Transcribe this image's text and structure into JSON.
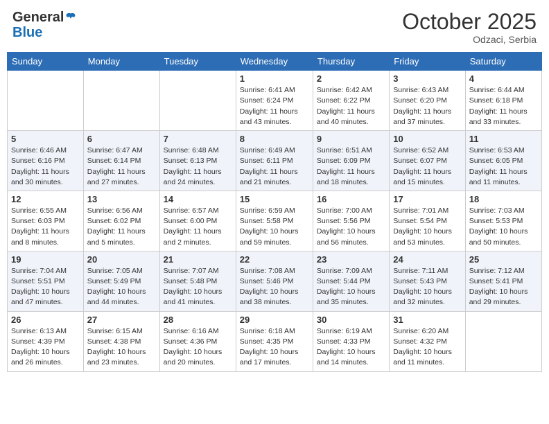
{
  "header": {
    "logo_general": "General",
    "logo_blue": "Blue",
    "month_title": "October 2025",
    "location": "Odzaci, Serbia"
  },
  "days_of_week": [
    "Sunday",
    "Monday",
    "Tuesday",
    "Wednesday",
    "Thursday",
    "Friday",
    "Saturday"
  ],
  "weeks": [
    [
      {
        "day": "",
        "detail": ""
      },
      {
        "day": "",
        "detail": ""
      },
      {
        "day": "",
        "detail": ""
      },
      {
        "day": "1",
        "detail": "Sunrise: 6:41 AM\nSunset: 6:24 PM\nDaylight: 11 hours\nand 43 minutes."
      },
      {
        "day": "2",
        "detail": "Sunrise: 6:42 AM\nSunset: 6:22 PM\nDaylight: 11 hours\nand 40 minutes."
      },
      {
        "day": "3",
        "detail": "Sunrise: 6:43 AM\nSunset: 6:20 PM\nDaylight: 11 hours\nand 37 minutes."
      },
      {
        "day": "4",
        "detail": "Sunrise: 6:44 AM\nSunset: 6:18 PM\nDaylight: 11 hours\nand 33 minutes."
      }
    ],
    [
      {
        "day": "5",
        "detail": "Sunrise: 6:46 AM\nSunset: 6:16 PM\nDaylight: 11 hours\nand 30 minutes."
      },
      {
        "day": "6",
        "detail": "Sunrise: 6:47 AM\nSunset: 6:14 PM\nDaylight: 11 hours\nand 27 minutes."
      },
      {
        "day": "7",
        "detail": "Sunrise: 6:48 AM\nSunset: 6:13 PM\nDaylight: 11 hours\nand 24 minutes."
      },
      {
        "day": "8",
        "detail": "Sunrise: 6:49 AM\nSunset: 6:11 PM\nDaylight: 11 hours\nand 21 minutes."
      },
      {
        "day": "9",
        "detail": "Sunrise: 6:51 AM\nSunset: 6:09 PM\nDaylight: 11 hours\nand 18 minutes."
      },
      {
        "day": "10",
        "detail": "Sunrise: 6:52 AM\nSunset: 6:07 PM\nDaylight: 11 hours\nand 15 minutes."
      },
      {
        "day": "11",
        "detail": "Sunrise: 6:53 AM\nSunset: 6:05 PM\nDaylight: 11 hours\nand 11 minutes."
      }
    ],
    [
      {
        "day": "12",
        "detail": "Sunrise: 6:55 AM\nSunset: 6:03 PM\nDaylight: 11 hours\nand 8 minutes."
      },
      {
        "day": "13",
        "detail": "Sunrise: 6:56 AM\nSunset: 6:02 PM\nDaylight: 11 hours\nand 5 minutes."
      },
      {
        "day": "14",
        "detail": "Sunrise: 6:57 AM\nSunset: 6:00 PM\nDaylight: 11 hours\nand 2 minutes."
      },
      {
        "day": "15",
        "detail": "Sunrise: 6:59 AM\nSunset: 5:58 PM\nDaylight: 10 hours\nand 59 minutes."
      },
      {
        "day": "16",
        "detail": "Sunrise: 7:00 AM\nSunset: 5:56 PM\nDaylight: 10 hours\nand 56 minutes."
      },
      {
        "day": "17",
        "detail": "Sunrise: 7:01 AM\nSunset: 5:54 PM\nDaylight: 10 hours\nand 53 minutes."
      },
      {
        "day": "18",
        "detail": "Sunrise: 7:03 AM\nSunset: 5:53 PM\nDaylight: 10 hours\nand 50 minutes."
      }
    ],
    [
      {
        "day": "19",
        "detail": "Sunrise: 7:04 AM\nSunset: 5:51 PM\nDaylight: 10 hours\nand 47 minutes."
      },
      {
        "day": "20",
        "detail": "Sunrise: 7:05 AM\nSunset: 5:49 PM\nDaylight: 10 hours\nand 44 minutes."
      },
      {
        "day": "21",
        "detail": "Sunrise: 7:07 AM\nSunset: 5:48 PM\nDaylight: 10 hours\nand 41 minutes."
      },
      {
        "day": "22",
        "detail": "Sunrise: 7:08 AM\nSunset: 5:46 PM\nDaylight: 10 hours\nand 38 minutes."
      },
      {
        "day": "23",
        "detail": "Sunrise: 7:09 AM\nSunset: 5:44 PM\nDaylight: 10 hours\nand 35 minutes."
      },
      {
        "day": "24",
        "detail": "Sunrise: 7:11 AM\nSunset: 5:43 PM\nDaylight: 10 hours\nand 32 minutes."
      },
      {
        "day": "25",
        "detail": "Sunrise: 7:12 AM\nSunset: 5:41 PM\nDaylight: 10 hours\nand 29 minutes."
      }
    ],
    [
      {
        "day": "26",
        "detail": "Sunrise: 6:13 AM\nSunset: 4:39 PM\nDaylight: 10 hours\nand 26 minutes."
      },
      {
        "day": "27",
        "detail": "Sunrise: 6:15 AM\nSunset: 4:38 PM\nDaylight: 10 hours\nand 23 minutes."
      },
      {
        "day": "28",
        "detail": "Sunrise: 6:16 AM\nSunset: 4:36 PM\nDaylight: 10 hours\nand 20 minutes."
      },
      {
        "day": "29",
        "detail": "Sunrise: 6:18 AM\nSunset: 4:35 PM\nDaylight: 10 hours\nand 17 minutes."
      },
      {
        "day": "30",
        "detail": "Sunrise: 6:19 AM\nSunset: 4:33 PM\nDaylight: 10 hours\nand 14 minutes."
      },
      {
        "day": "31",
        "detail": "Sunrise: 6:20 AM\nSunset: 4:32 PM\nDaylight: 10 hours\nand 11 minutes."
      },
      {
        "day": "",
        "detail": ""
      }
    ]
  ]
}
